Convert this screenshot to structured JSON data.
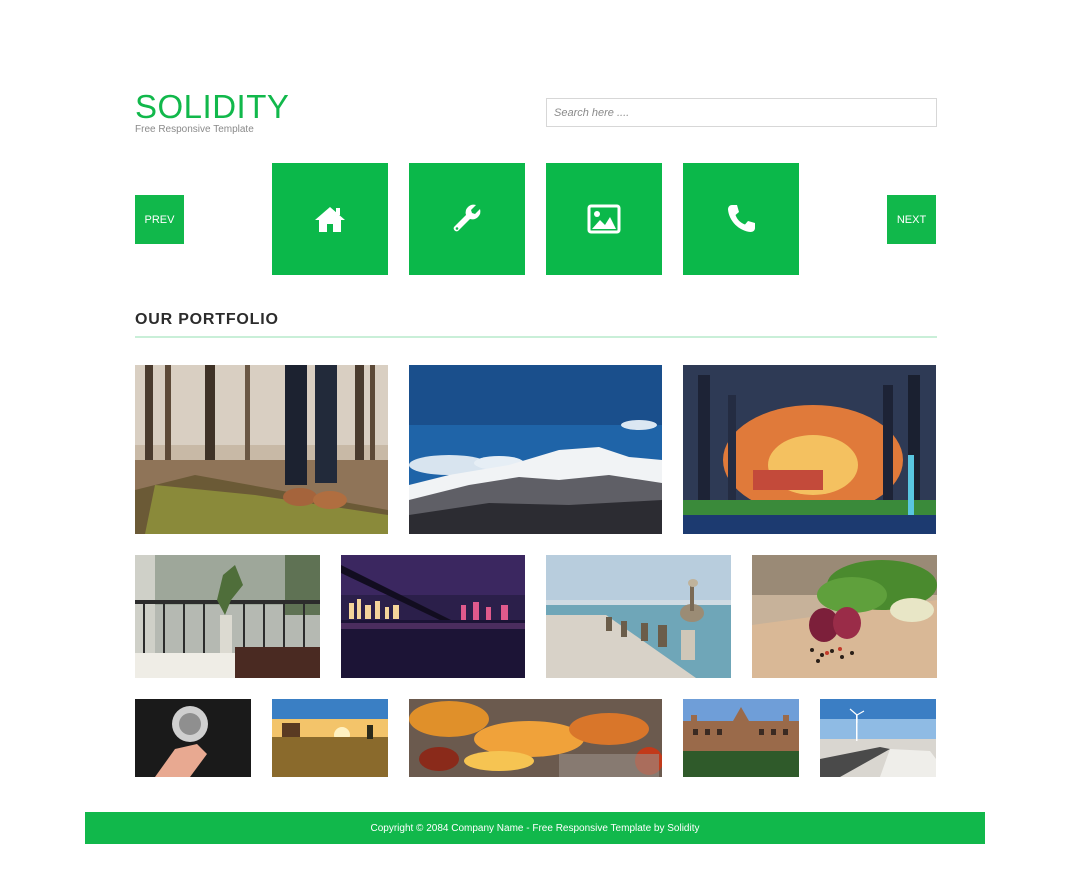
{
  "brand": {
    "title": "SOLIDITY",
    "tagline": "Free Responsive Template"
  },
  "search": {
    "placeholder": "Search here ...."
  },
  "nav": {
    "prev_label": "PREV",
    "next_label": "NEXT",
    "tiles": [
      {
        "icon": "home-icon"
      },
      {
        "icon": "wrench-icon"
      },
      {
        "icon": "image-icon"
      },
      {
        "icon": "phone-icon"
      }
    ]
  },
  "portfolio": {
    "title": "OUR PORTFOLIO",
    "rows": [
      [
        "forest-boots-photo",
        "snowy-mountains-photo",
        "tree-alley-sunset-photo"
      ],
      [
        "balcony-plant-photo",
        "city-bridge-night-photo",
        "pelican-pier-photo",
        "onion-salad-photo"
      ],
      [
        "dandelion-hand-photo",
        "sunset-field-photo",
        "autumn-leaves-photo",
        "college-building-photo",
        "wind-turbine-road-photo"
      ]
    ]
  },
  "footer": {
    "text": "Copyright © 2084 Company Name - Free Responsive Template by Solidity"
  },
  "colors": {
    "accent": "#11b84b",
    "rule": "#c9efd8",
    "text": "#2c2c2c"
  }
}
